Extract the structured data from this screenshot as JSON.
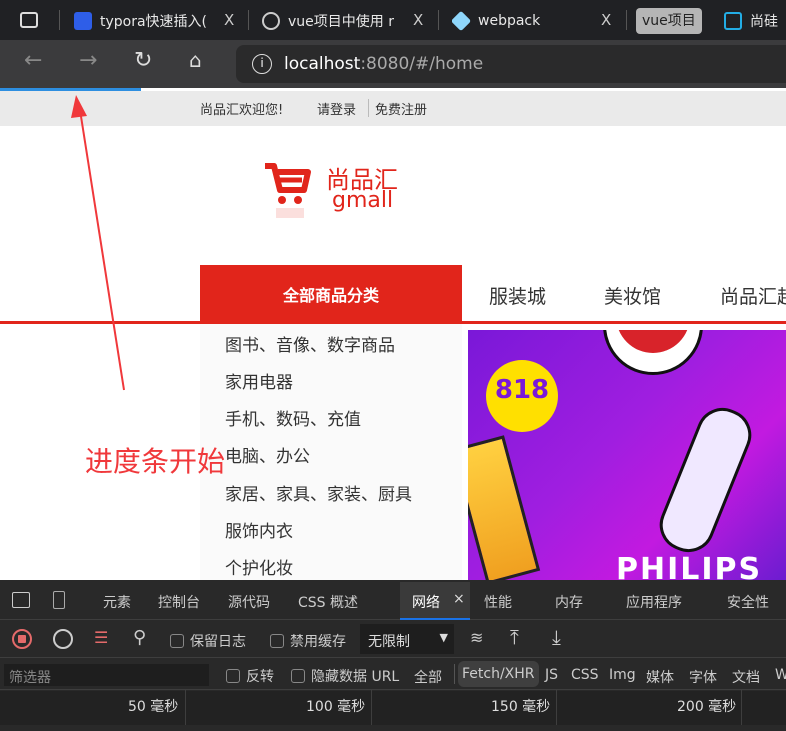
{
  "browser": {
    "tabs": [
      {
        "title": "typora快速插入(",
        "close": "X"
      },
      {
        "title": "vue项目中使用 r",
        "close": "X"
      },
      {
        "title": "webpack",
        "close": "X"
      },
      {
        "title": "vue项目"
      },
      {
        "title": "尚硅"
      }
    ],
    "url": {
      "host": "localhost",
      "rest": ":8080/#/home"
    },
    "loading_progress": 0.18
  },
  "site": {
    "welcome": "尚品汇欢迎您!",
    "login": "请登录",
    "register": "免费注册",
    "logo": {
      "cn": "尚品汇",
      "en": "gmall"
    },
    "all_categories": "全部商品分类",
    "nav_links": [
      "服装城",
      "美妆馆",
      "尚品汇超市"
    ],
    "categories": [
      "图书、音像、数字商品",
      "家用电器",
      "手机、数码、充值",
      "电脑、办公",
      "家居、家具、家装、厨具",
      "服饰内衣",
      "个护化妆"
    ],
    "banner_text": "PHILIPS"
  },
  "annotation": "进度条开始",
  "devtools": {
    "tabs": [
      "元素",
      "控制台",
      "源代码",
      "CSS 概述",
      "网络",
      "性能",
      "内存",
      "应用程序",
      "安全性"
    ],
    "active_tab": "网络",
    "close": "×",
    "preserve_log": "保留日志",
    "disable_cache": "禁用缓存",
    "throttle": "无限制",
    "filter_placeholder": "筛选器",
    "invert": "反转",
    "hide_data_urls": "隐藏数据 URL",
    "types": [
      "全部",
      "Fetch/XHR",
      "JS",
      "CSS",
      "Img",
      "媒体",
      "字体",
      "文档",
      "W"
    ],
    "timeline": [
      "50 毫秒",
      "100 毫秒",
      "150 毫秒",
      "200 毫秒"
    ]
  }
}
